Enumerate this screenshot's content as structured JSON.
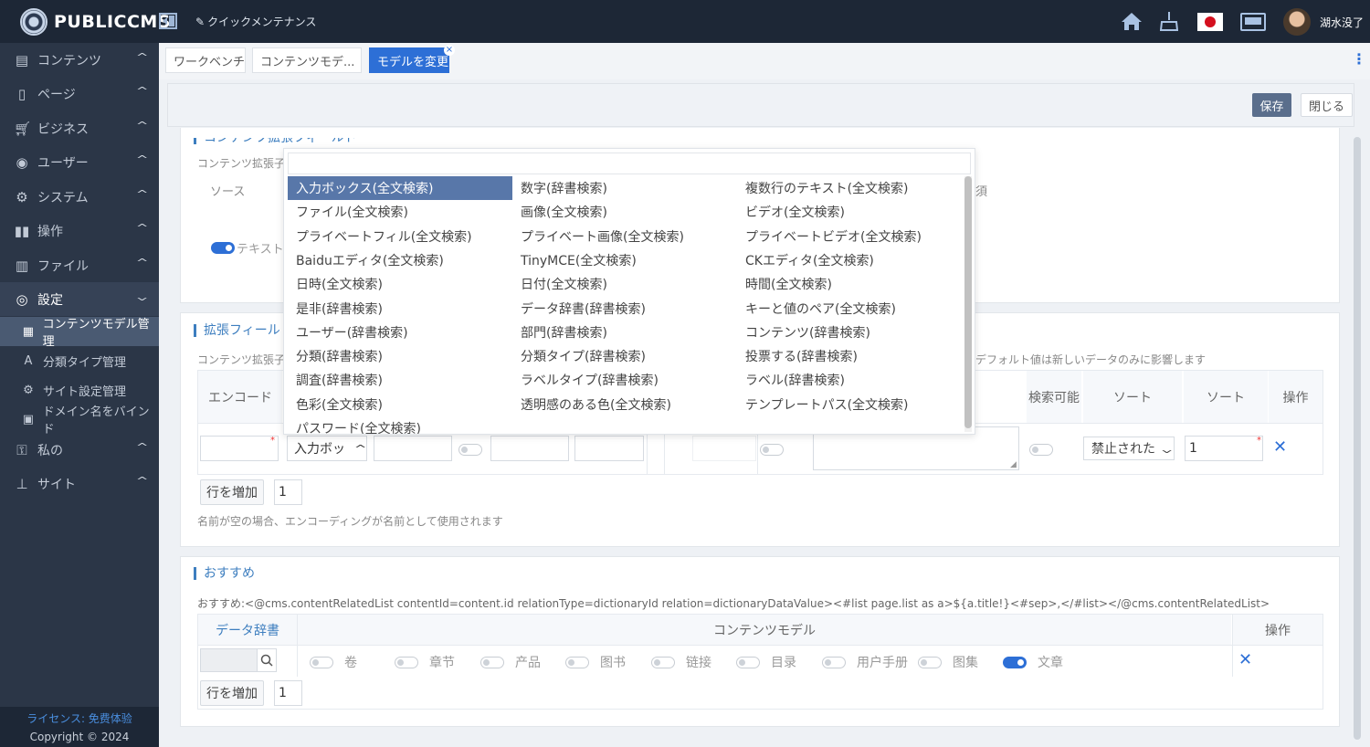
{
  "app": {
    "name": "PUBLICCMS",
    "quick_maintenance": "クイックメンテナンス",
    "user_name": "湖水没了"
  },
  "sidebar": {
    "items": [
      {
        "label": "コンテンツ",
        "icon": "document-icon"
      },
      {
        "label": "ページ",
        "icon": "tablet-icon"
      },
      {
        "label": "ビジネス",
        "icon": "cart-icon"
      },
      {
        "label": "ユーザー",
        "icon": "user-icon"
      },
      {
        "label": "システム",
        "icon": "gears-icon"
      },
      {
        "label": "操作",
        "icon": "binoculars-icon"
      },
      {
        "label": "ファイル",
        "icon": "file-icon"
      },
      {
        "label": "設定",
        "icon": "settings-icon"
      }
    ],
    "subitems": [
      {
        "label": "コンテンツモデル管理",
        "icon": "grid-icon"
      },
      {
        "label": "分類タイプ管理",
        "icon": "font-icon"
      },
      {
        "label": "サイト設定管理",
        "icon": "gears-icon"
      },
      {
        "label": "ドメイン名をバインド",
        "icon": "qrcode-icon"
      }
    ],
    "items2": [
      {
        "label": "私の",
        "icon": "key-icon"
      },
      {
        "label": "サイト",
        "icon": "sitemap-icon"
      }
    ],
    "license": "ライセンス: 免费体验",
    "copyright": "Copyright © 2024"
  },
  "tabs": [
    "ワークベンチ",
    "コンテンツモデ...",
    "モデルを変更"
  ],
  "toolbar": {
    "save": "保存",
    "close": "閉じる"
  },
  "section1": {
    "title": "コンテンツ拡張フィールド",
    "hint": "コンテンツ拡張子",
    "source_label": "ソース",
    "required_label": "須",
    "text_label": "テキスト"
  },
  "section2": {
    "title": "拡張フィールド",
    "hint": "コンテンツ拡張子",
    "hint_right": "デフォルト値は新しいデータのみに影響します",
    "headers": {
      "encode": "エンコード",
      "searchable": "検索可能",
      "sort1": "ソート",
      "sort2": "ソート",
      "ops": "操作"
    },
    "type_select": "入力ボッ",
    "sort_select": "禁止された",
    "sort_value": "1",
    "add_row": "行を増加",
    "add_count": "1",
    "footnote": "名前が空の場合、エンコーディングが名前として使用されます"
  },
  "dropdown": {
    "options": [
      "入力ボックス(全文検索)",
      "数字(辞書検索)",
      "複数行のテキスト(全文検索)",
      "ファイル(全文検索)",
      "画像(全文検索)",
      "ビデオ(全文検索)",
      "プライベートフィル(全文検索)",
      "プライベート画像(全文検索)",
      "プライベートビデオ(全文検索)",
      "Baiduエディタ(全文検索)",
      "TinyMCE(全文検索)",
      "CKエディタ(全文検索)",
      "日時(全文検索)",
      "日付(全文検索)",
      "時間(全文検索)",
      "是非(辞書検索)",
      "データ辞書(辞書検索)",
      "キーと値のペア(全文検索)",
      "ユーザー(辞書検索)",
      "部門(辞書検索)",
      "コンテンツ(辞書検索)",
      "分類(辞書検索)",
      "分類タイプ(辞書検索)",
      "投票する(辞書検索)",
      "調査(辞書検索)",
      "ラベルタイプ(辞書検索)",
      "ラベル(辞書検索)",
      "色彩(全文検索)",
      "透明感のある色(全文検索)",
      "テンプレートパス(全文検索)",
      "パスワード(全文検索)"
    ],
    "selected_index": 0
  },
  "section3": {
    "title": "おすすめ",
    "code": "おすすめ:<@cms.contentRelatedList contentId=content.id relationType=dictionaryId relation=dictionaryDataValue><#list page.list as a>${a.title!}<#sep>,</#list></@cms.contentRelatedList>",
    "headers": {
      "dict": "データ辞書",
      "model": "コンテンツモデル",
      "ops": "操作"
    },
    "models": [
      {
        "label": "卷",
        "on": false
      },
      {
        "label": "章节",
        "on": false
      },
      {
        "label": "产品",
        "on": false
      },
      {
        "label": "图书",
        "on": false
      },
      {
        "label": "链接",
        "on": false
      },
      {
        "label": "目录",
        "on": false
      },
      {
        "label": "用户手册",
        "on": false
      },
      {
        "label": "图集",
        "on": false
      },
      {
        "label": "文章",
        "on": true
      }
    ],
    "add_row": "行を増加",
    "add_count": "1"
  },
  "colors": {
    "topbar": "#1d2736",
    "sidebar": "#2b3647",
    "accent": "#2d6fd6",
    "title_blue": "#3d7ebf"
  }
}
